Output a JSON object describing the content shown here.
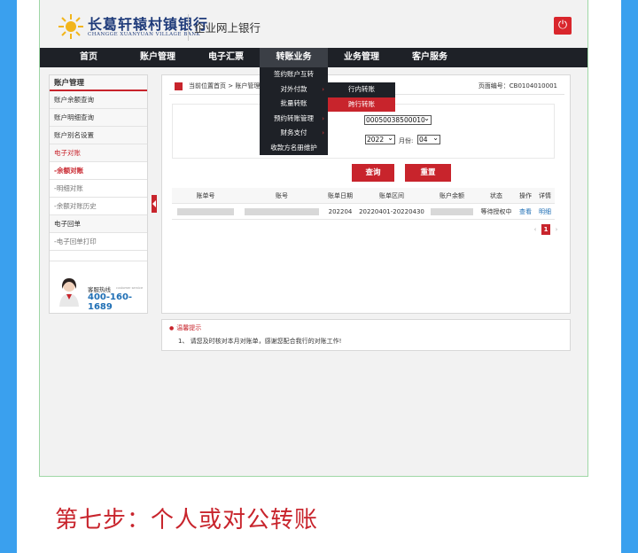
{
  "bank": {
    "name": "长葛轩辕村镇银行",
    "name_en": "CHANGGE XUANYUAN VILLAGE BANK",
    "subtitle": "企业网上银行"
  },
  "nav": [
    "首页",
    "账户管理",
    "电子汇票",
    "转账业务",
    "业务管理",
    "客户服务"
  ],
  "nav_active": "转账业务",
  "dropdown": {
    "items": [
      "签约账户互转",
      "对外付款",
      "批量转账",
      "预约转账管理",
      "财务支付",
      "收款方名册维护"
    ],
    "submenu": [
      "行内转账",
      "跨行转账"
    ],
    "submenu_highlight": "跨行转账"
  },
  "sidebar": {
    "title": "账户管理",
    "items": [
      "账户余额查询",
      "账户明细查询",
      "账户别名设置",
      "电子对账",
      "-余额对账",
      "-明细对账",
      "-余额对账历史",
      "电子回单",
      "-电子回单打印"
    ],
    "hotline_label": "客服热线",
    "hotline_en": "customer service",
    "hotline_number": "400-160-1689"
  },
  "panel": {
    "breadcrumb": "当前位置首页 > 账户管理",
    "page_code": "页面编号：CB0104010001",
    "account_value": "00050038500010",
    "year_value": "2022",
    "month_label": "月份:",
    "month_value": "04",
    "query_button": "查询",
    "reset_button": "重置"
  },
  "table": {
    "headers": [
      "账单号",
      "账号",
      "账单日期",
      "账单区间",
      "账户余额",
      "状态",
      "操作",
      "详情"
    ],
    "rows": [
      {
        "bill_date": "202204",
        "period": "20220401-20220430",
        "status": "等待授权中",
        "action": "查看",
        "detail": "明细"
      }
    ]
  },
  "pager": {
    "prev": "‹",
    "current": "1",
    "next": "›"
  },
  "tips": {
    "title": "温馨提示",
    "text": "1、 请您及时核对本月对账单，感谢您配合我行的对账工作!"
  },
  "caption": "第七步：个人或对公转账",
  "colors": {
    "accent": "#c8242c",
    "nav_bg": "#1e2127",
    "edge_blue": "#3aa0ee",
    "link": "#1f6fb5"
  }
}
